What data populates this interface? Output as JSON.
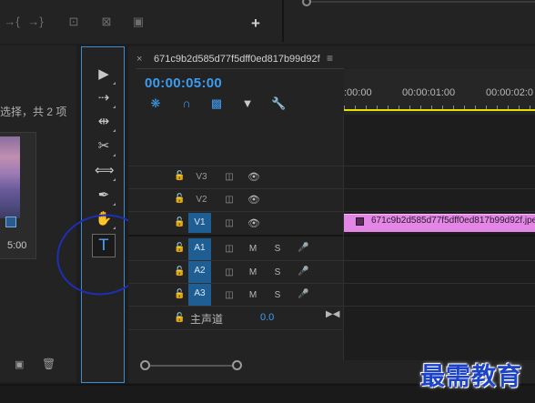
{
  "top_toolbar": {
    "icons": [
      "play-in-icon",
      "step-forward-icon",
      "lift-icon",
      "extract-icon",
      "camera-icon",
      "add-button-icon"
    ],
    "glyphs": [
      "→{",
      "→}",
      "⊡",
      "⊠",
      "▣",
      "+"
    ]
  },
  "project": {
    "selection_text": "选择，共 2 项",
    "thumb_duration": "5:00"
  },
  "tools": {
    "items": [
      "selection-tool",
      "track-select-tool",
      "ripple-edit-tool",
      "razor-tool",
      "slip-tool",
      "pen-tool",
      "hand-tool"
    ],
    "glyphs": [
      "▶",
      "⇢",
      "⇹",
      "✂",
      "⟺",
      "✒",
      "✋"
    ],
    "type_tool_glyph": "T"
  },
  "sequence": {
    "close_glyph": "×",
    "title": "671c9b2d585d77f5dff0ed817b99d92f",
    "menu_glyph": "≡",
    "timecode": "00:00:05:00",
    "ruler_labels": [
      ":00:00",
      "00:00:01:00",
      "00:00:02:0"
    ]
  },
  "tracks": {
    "video": [
      {
        "label": "V3",
        "active": false
      },
      {
        "label": "V2",
        "active": false
      },
      {
        "label": "V1",
        "active": true
      }
    ],
    "audio": [
      {
        "label": "A1",
        "mute": "M",
        "solo": "S"
      },
      {
        "label": "A2",
        "mute": "M",
        "solo": "S"
      },
      {
        "label": "A3",
        "mute": "M",
        "solo": "S"
      }
    ],
    "master_label": "主声道",
    "master_value": "0.0"
  },
  "clip": {
    "label": "671c9b2d585d77f5dff0ed817b99d92f.jpeg",
    "color": "#e486e6"
  },
  "watermark": "最需教育",
  "colors": {
    "accent": "#3d9cf0",
    "track_active": "#1f5e93",
    "work_area": "#e8e000",
    "annotation": "#1d2fb5"
  }
}
